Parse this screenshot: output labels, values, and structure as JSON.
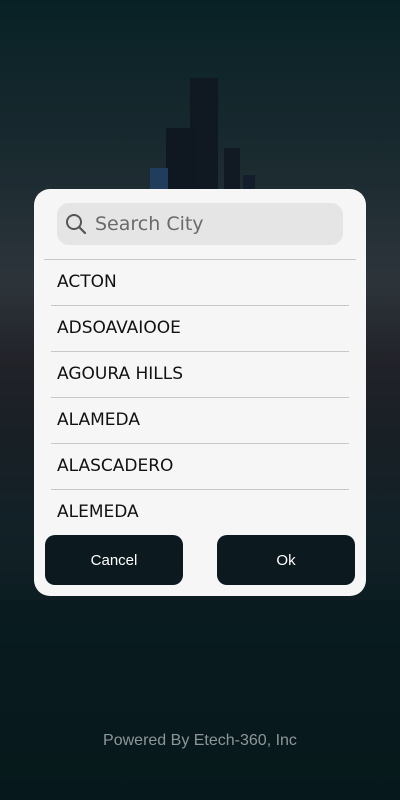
{
  "search": {
    "placeholder": "Search City"
  },
  "cities": [
    "ACTON",
    "ADSOAVAIOOE",
    "AGOURA HILLS",
    "ALAMEDA",
    "ALASCADERO",
    "ALEMEDA"
  ],
  "buttons": {
    "cancel": "Cancel",
    "ok": "Ok"
  },
  "footer": {
    "text": "Powered By Etech-360, Inc"
  },
  "colors": {
    "button_bg": "#0c1a1f",
    "dialog_bg": "#f6f6f6",
    "search_bg": "#e5e5e5"
  }
}
